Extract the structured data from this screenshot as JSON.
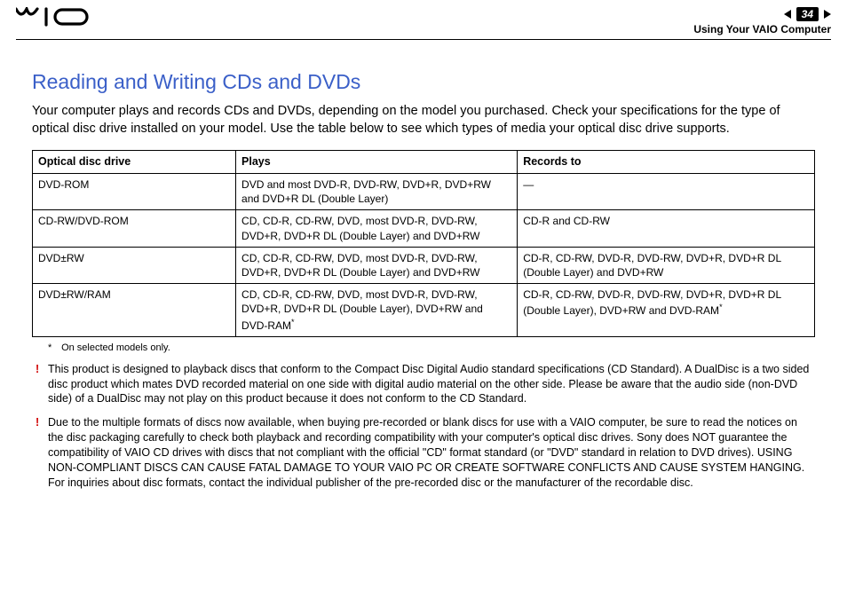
{
  "header": {
    "page_number": "34",
    "section_label": "Using Your VAIO Computer"
  },
  "title": "Reading and Writing CDs and DVDs",
  "intro": "Your computer plays and records CDs and DVDs, depending on the model you purchased. Check your specifications for the type of optical disc drive installed on your model. Use the table below to see which types of media your optical disc drive supports.",
  "table": {
    "headers": {
      "c1": "Optical disc drive",
      "c2": "Plays",
      "c3": "Records to"
    },
    "rows": [
      {
        "drive": "DVD-ROM",
        "plays": "DVD and most DVD-R, DVD-RW, DVD+R, DVD+RW and DVD+R DL (Double Layer)",
        "records": "—"
      },
      {
        "drive": "CD-RW/DVD-ROM",
        "plays": "CD, CD-R, CD-RW, DVD, most DVD-R, DVD-RW, DVD+R, DVD+R DL (Double Layer) and DVD+RW",
        "records": "CD-R and CD-RW"
      },
      {
        "drive": "DVD±RW",
        "plays": "CD, CD-R, CD-RW, DVD, most DVD-R, DVD-RW, DVD+R, DVD+R DL (Double Layer) and DVD+RW",
        "records": "CD-R, CD-RW, DVD-R, DVD-RW, DVD+R, DVD+R DL (Double Layer) and DVD+RW"
      },
      {
        "drive": "DVD±RW/RAM",
        "plays_pre": "CD, CD-R, CD-RW, DVD, most DVD-R, DVD-RW, DVD+R, DVD+R DL (Double Layer), DVD+RW and DVD-RAM",
        "plays_ast": "*",
        "records_pre": "CD-R, CD-RW, DVD-R, DVD-RW, DVD+R, DVD+R DL (Double Layer), DVD+RW and DVD-RAM",
        "records_ast": "*"
      }
    ]
  },
  "footnote": {
    "mark": "*",
    "text": "On selected models only."
  },
  "warnings": [
    "This product is designed to playback discs that conform to the Compact Disc Digital Audio standard specifications (CD Standard). A DualDisc is a two sided disc product which mates DVD recorded material on one side with digital audio material on the other side. Please be aware that the audio side (non-DVD side) of a DualDisc may not play on this product because it does not conform to the CD Standard.",
    "Due to the multiple formats of discs now available, when buying pre-recorded or blank discs for use with a VAIO computer, be sure to read the notices on the disc packaging carefully to check both playback and recording compatibility with your computer's optical disc drives. Sony does NOT guarantee the compatibility of VAIO CD drives with discs that not compliant with the official \"CD\" format standard (or \"DVD\" standard in relation to DVD drives). USING NON-COMPLIANT DISCS CAN CAUSE FATAL DAMAGE TO YOUR VAIO PC OR CREATE SOFTWARE CONFLICTS AND CAUSE SYSTEM HANGING. For inquiries about disc formats, contact the individual publisher of the pre-recorded disc or the manufacturer of the recordable disc."
  ]
}
